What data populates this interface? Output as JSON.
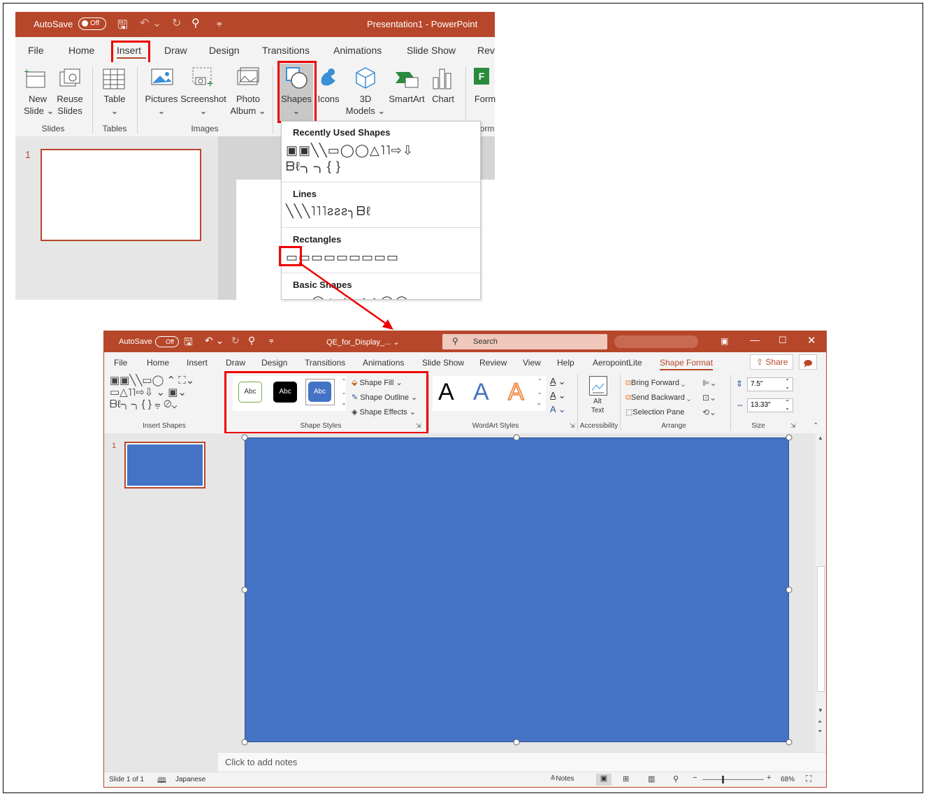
{
  "top": {
    "titlebar": {
      "autosave": "AutoSave",
      "toggle": "Off",
      "title": "Presentation1  -  PowerPoint"
    },
    "tabs": [
      "File",
      "Home",
      "Insert",
      "Draw",
      "Design",
      "Transitions",
      "Animations",
      "Slide Show",
      "Rev"
    ],
    "buttons": {
      "new_slide": "New\nSlide ⌄",
      "reuse": "Reuse\nSlides",
      "table": "Table",
      "pictures": "Pictures",
      "screenshot": "Screenshot",
      "photo_album": "Photo\nAlbum ⌄",
      "shapes": "Shapes",
      "icons": "Icons",
      "models": "3D\nModels ⌄",
      "smartart": "SmartArt",
      "chart": "Chart",
      "form": "Form"
    },
    "groups": {
      "slides": "Slides",
      "tables": "Tables",
      "images": "Images",
      "form": "orm"
    },
    "slide_num": "1",
    "menu": {
      "recent": "Recently Used Shapes",
      "recent_row1": "▣▣╲╲▭◯◯△˥˥⇨⇩",
      "recent_row2": "ᗷℓ╮╮{ }",
      "lines": "Lines",
      "lines_row": "╲╲╲˥˥˥ƨƨƨ╮ᗷℓ",
      "rectangles": "Rectangles",
      "rect_row": "▭▭▭▭▭▭▭▭▭",
      "basic": "Basic Shapes"
    }
  },
  "bottom": {
    "titlebar": {
      "autosave": "AutoSave",
      "toggle": "Off",
      "file": "QE_for_Display_...  ⌄",
      "search": "Search"
    },
    "tabs": [
      "File",
      "Home",
      "Insert",
      "Draw",
      "Design",
      "Transitions",
      "Animations",
      "Slide Show",
      "Review",
      "View",
      "Help",
      "AeropointLite",
      "Shape Format"
    ],
    "share": "Share",
    "ribbon": {
      "style_abc": "Abc",
      "shape_fill": "Shape Fill ⌄",
      "shape_outline": "Shape Outline ⌄",
      "shape_effects": "Shape Effects ⌄",
      "wordart": "A",
      "alt_text": "Alt\nText",
      "bring_forward": "Bring Forward",
      "send_backward": "Send Backward",
      "selection_pane": "Selection Pane",
      "height": "7.5\"",
      "width": "13.33\""
    },
    "groups": {
      "insert_shapes": "Insert Shapes",
      "shape_styles": "Shape Styles",
      "wordart_styles": "WordArt Styles",
      "accessibility": "Accessibility",
      "arrange": "Arrange",
      "size": "Size"
    },
    "slide_num": "1",
    "notes_placeholder": "Click to add notes",
    "status": {
      "slide": "Slide 1 of 1",
      "lang": "Japanese",
      "notes": "Notes",
      "zoom": "68%"
    },
    "colors": {
      "shape_fill": "#4472c4",
      "accent": "#b7472a"
    }
  }
}
